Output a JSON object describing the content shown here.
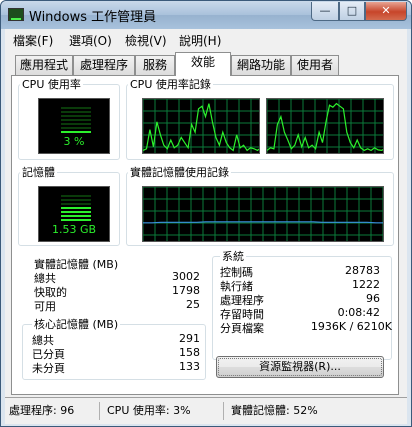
{
  "window": {
    "title": "Windows 工作管理員",
    "controls": {
      "minimize": "—",
      "maximize": "□",
      "close": "✕"
    },
    "icon": "task-manager-icon"
  },
  "menu": [
    "檔案(F)",
    "選項(O)",
    "檢視(V)",
    "說明(H)"
  ],
  "tabs": [
    {
      "label": "應用程式",
      "active": false
    },
    {
      "label": "處理程序",
      "active": false
    },
    {
      "label": "服務",
      "active": false
    },
    {
      "label": "效能",
      "active": true
    },
    {
      "label": "網路功能",
      "active": false
    },
    {
      "label": "使用者",
      "active": false
    }
  ],
  "cpu": {
    "label": "CPU 使用率",
    "value_text": "3 %",
    "level": 0.03,
    "history_label": "CPU 使用率記錄",
    "history_core1": [
      0.05,
      0.08,
      0.45,
      0.12,
      0.6,
      0.35,
      0.15,
      0.08,
      0.25,
      0.1,
      0.15,
      0.3,
      0.2,
      0.1,
      0.55,
      0.4,
      0.85,
      0.9,
      0.7,
      0.95,
      0.6,
      0.3,
      0.15,
      0.4,
      0.2,
      0.1,
      0.05,
      0.35,
      0.1,
      0.15,
      0.05,
      0.1,
      0.08,
      0.05,
      0.1
    ],
    "history_core2": [
      0.05,
      0.1,
      0.08,
      0.55,
      0.7,
      0.4,
      0.25,
      0.08,
      0.15,
      0.35,
      0.12,
      0.3,
      0.1,
      0.15,
      0.08,
      0.4,
      0.2,
      0.6,
      0.92,
      0.88,
      0.95,
      0.9,
      0.85,
      0.4,
      0.2,
      0.1,
      0.25,
      0.1,
      0.05,
      0.08,
      0.05,
      0.1,
      0.06,
      0.05,
      0.08
    ]
  },
  "memory": {
    "label": "記憶體",
    "value_text": "1.53 GB",
    "level": 0.52,
    "history_label": "實體記憶體使用記錄",
    "history": [
      0.35,
      0.35,
      0.36,
      0.36,
      0.36,
      0.36,
      0.36,
      0.37,
      0.37,
      0.37,
      0.37,
      0.37,
      0.37,
      0.37,
      0.37,
      0.37,
      0.37,
      0.37,
      0.37,
      0.37,
      0.36,
      0.36,
      0.36,
      0.36,
      0.36,
      0.36,
      0.35,
      0.35
    ]
  },
  "physical": {
    "title": "實體記憶體 (MB)",
    "rows": [
      {
        "label": "總共",
        "value": "3002"
      },
      {
        "label": "快取的",
        "value": "1798"
      },
      {
        "label": "可用",
        "value": "25"
      }
    ]
  },
  "kernel": {
    "title": "核心記憶體 (MB)",
    "rows": [
      {
        "label": "總共",
        "value": "291"
      },
      {
        "label": "已分頁",
        "value": "158"
      },
      {
        "label": "未分頁",
        "value": "133"
      }
    ]
  },
  "system": {
    "title": "系統",
    "rows": [
      {
        "label": "控制碼",
        "value": "28783"
      },
      {
        "label": "執行緒",
        "value": "1222"
      },
      {
        "label": "處理程序",
        "value": "96"
      },
      {
        "label": "存留時間",
        "value": "0:08:42"
      },
      {
        "label": "分頁檔案",
        "value": "1936K / 6210K"
      }
    ]
  },
  "resource_button": "資源監視器(R)...",
  "status": {
    "processes": "處理程序: 96",
    "cpu": "CPU 使用率: 3%",
    "memory": "實體記憶體: 52%"
  },
  "colors": {
    "graph_line": "#2cf02c",
    "grid": "#0b7a3a",
    "memory_line": "#3b8ede"
  }
}
